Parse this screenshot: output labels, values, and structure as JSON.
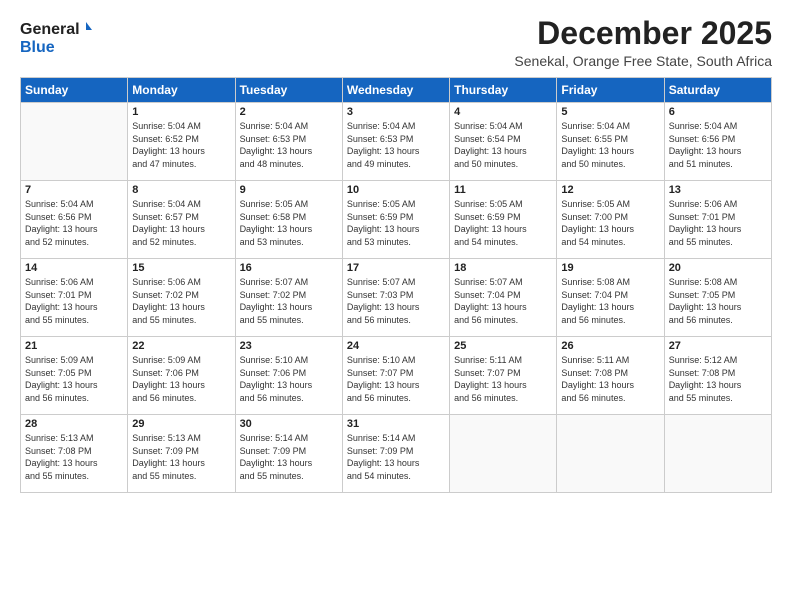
{
  "header": {
    "logo_general": "General",
    "logo_blue": "Blue",
    "month": "December 2025",
    "location": "Senekal, Orange Free State, South Africa"
  },
  "weekdays": [
    "Sunday",
    "Monday",
    "Tuesday",
    "Wednesday",
    "Thursday",
    "Friday",
    "Saturday"
  ],
  "weeks": [
    [
      {
        "day": "",
        "info": ""
      },
      {
        "day": "1",
        "info": "Sunrise: 5:04 AM\nSunset: 6:52 PM\nDaylight: 13 hours\nand 47 minutes."
      },
      {
        "day": "2",
        "info": "Sunrise: 5:04 AM\nSunset: 6:53 PM\nDaylight: 13 hours\nand 48 minutes."
      },
      {
        "day": "3",
        "info": "Sunrise: 5:04 AM\nSunset: 6:53 PM\nDaylight: 13 hours\nand 49 minutes."
      },
      {
        "day": "4",
        "info": "Sunrise: 5:04 AM\nSunset: 6:54 PM\nDaylight: 13 hours\nand 50 minutes."
      },
      {
        "day": "5",
        "info": "Sunrise: 5:04 AM\nSunset: 6:55 PM\nDaylight: 13 hours\nand 50 minutes."
      },
      {
        "day": "6",
        "info": "Sunrise: 5:04 AM\nSunset: 6:56 PM\nDaylight: 13 hours\nand 51 minutes."
      }
    ],
    [
      {
        "day": "7",
        "info": "Sunrise: 5:04 AM\nSunset: 6:56 PM\nDaylight: 13 hours\nand 52 minutes."
      },
      {
        "day": "8",
        "info": "Sunrise: 5:04 AM\nSunset: 6:57 PM\nDaylight: 13 hours\nand 52 minutes."
      },
      {
        "day": "9",
        "info": "Sunrise: 5:05 AM\nSunset: 6:58 PM\nDaylight: 13 hours\nand 53 minutes."
      },
      {
        "day": "10",
        "info": "Sunrise: 5:05 AM\nSunset: 6:59 PM\nDaylight: 13 hours\nand 53 minutes."
      },
      {
        "day": "11",
        "info": "Sunrise: 5:05 AM\nSunset: 6:59 PM\nDaylight: 13 hours\nand 54 minutes."
      },
      {
        "day": "12",
        "info": "Sunrise: 5:05 AM\nSunset: 7:00 PM\nDaylight: 13 hours\nand 54 minutes."
      },
      {
        "day": "13",
        "info": "Sunrise: 5:06 AM\nSunset: 7:01 PM\nDaylight: 13 hours\nand 55 minutes."
      }
    ],
    [
      {
        "day": "14",
        "info": "Sunrise: 5:06 AM\nSunset: 7:01 PM\nDaylight: 13 hours\nand 55 minutes."
      },
      {
        "day": "15",
        "info": "Sunrise: 5:06 AM\nSunset: 7:02 PM\nDaylight: 13 hours\nand 55 minutes."
      },
      {
        "day": "16",
        "info": "Sunrise: 5:07 AM\nSunset: 7:02 PM\nDaylight: 13 hours\nand 55 minutes."
      },
      {
        "day": "17",
        "info": "Sunrise: 5:07 AM\nSunset: 7:03 PM\nDaylight: 13 hours\nand 56 minutes."
      },
      {
        "day": "18",
        "info": "Sunrise: 5:07 AM\nSunset: 7:04 PM\nDaylight: 13 hours\nand 56 minutes."
      },
      {
        "day": "19",
        "info": "Sunrise: 5:08 AM\nSunset: 7:04 PM\nDaylight: 13 hours\nand 56 minutes."
      },
      {
        "day": "20",
        "info": "Sunrise: 5:08 AM\nSunset: 7:05 PM\nDaylight: 13 hours\nand 56 minutes."
      }
    ],
    [
      {
        "day": "21",
        "info": "Sunrise: 5:09 AM\nSunset: 7:05 PM\nDaylight: 13 hours\nand 56 minutes."
      },
      {
        "day": "22",
        "info": "Sunrise: 5:09 AM\nSunset: 7:06 PM\nDaylight: 13 hours\nand 56 minutes."
      },
      {
        "day": "23",
        "info": "Sunrise: 5:10 AM\nSunset: 7:06 PM\nDaylight: 13 hours\nand 56 minutes."
      },
      {
        "day": "24",
        "info": "Sunrise: 5:10 AM\nSunset: 7:07 PM\nDaylight: 13 hours\nand 56 minutes."
      },
      {
        "day": "25",
        "info": "Sunrise: 5:11 AM\nSunset: 7:07 PM\nDaylight: 13 hours\nand 56 minutes."
      },
      {
        "day": "26",
        "info": "Sunrise: 5:11 AM\nSunset: 7:08 PM\nDaylight: 13 hours\nand 56 minutes."
      },
      {
        "day": "27",
        "info": "Sunrise: 5:12 AM\nSunset: 7:08 PM\nDaylight: 13 hours\nand 55 minutes."
      }
    ],
    [
      {
        "day": "28",
        "info": "Sunrise: 5:13 AM\nSunset: 7:08 PM\nDaylight: 13 hours\nand 55 minutes."
      },
      {
        "day": "29",
        "info": "Sunrise: 5:13 AM\nSunset: 7:09 PM\nDaylight: 13 hours\nand 55 minutes."
      },
      {
        "day": "30",
        "info": "Sunrise: 5:14 AM\nSunset: 7:09 PM\nDaylight: 13 hours\nand 55 minutes."
      },
      {
        "day": "31",
        "info": "Sunrise: 5:14 AM\nSunset: 7:09 PM\nDaylight: 13 hours\nand 54 minutes."
      },
      {
        "day": "",
        "info": ""
      },
      {
        "day": "",
        "info": ""
      },
      {
        "day": "",
        "info": ""
      }
    ]
  ]
}
